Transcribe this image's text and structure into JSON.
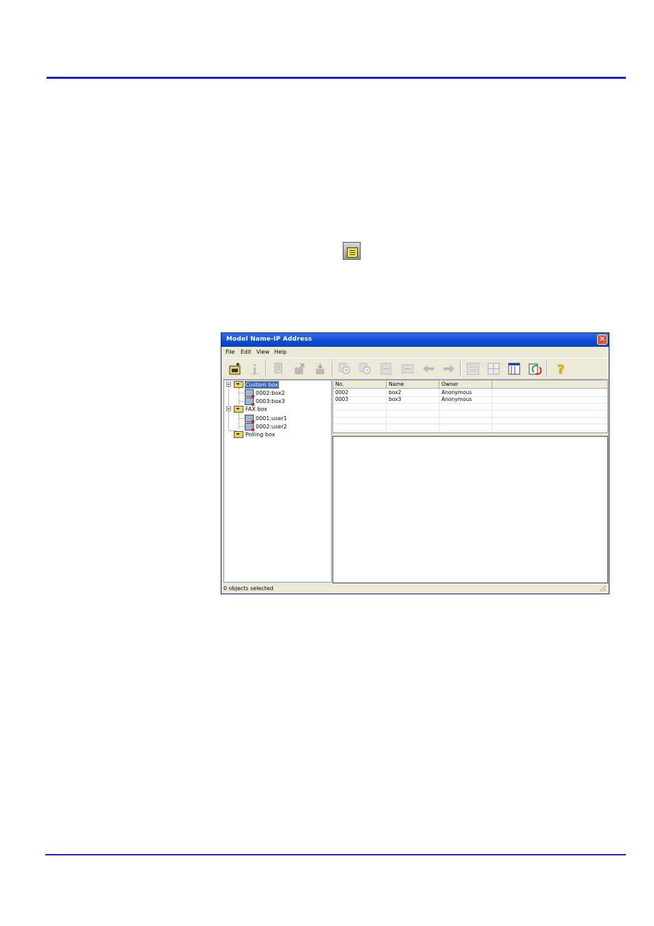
{
  "window": {
    "title": "Model Name-IP Address",
    "close_label": "✕"
  },
  "menu": [
    "File",
    "Edit",
    "View",
    "Help"
  ],
  "toolbar_icons": [
    "new-box-icon",
    "properties-icon",
    "copy-icon",
    "delete-icon",
    "move-icon",
    "zoom-in-icon",
    "zoom-out-icon",
    "fit-page-icon",
    "fit-width-icon",
    "back-arrow-icon",
    "forward-arrow-icon",
    "list-view-icon",
    "thumbnail-view-icon",
    "details-view-icon",
    "refresh-icon",
    "help-icon"
  ],
  "tree": {
    "custom_box": "Custom box",
    "custom_items": [
      "0002:box2",
      "0003:box3"
    ],
    "fax_box": "FAX box",
    "fax_items": [
      "0001:user1",
      "0002:user2"
    ],
    "polling_box": "Polling box"
  },
  "list": {
    "headers": [
      "No.",
      "Name",
      "Owner"
    ],
    "rows": [
      [
        "0002",
        "box2",
        "Anonymous"
      ],
      [
        "0003",
        "box3",
        "Anonymous"
      ]
    ]
  },
  "status": "0 objects selected",
  "colors": {
    "rule": "#1f1fb4",
    "title_bar": "#0e4bd4",
    "selection": "#316ac5"
  }
}
